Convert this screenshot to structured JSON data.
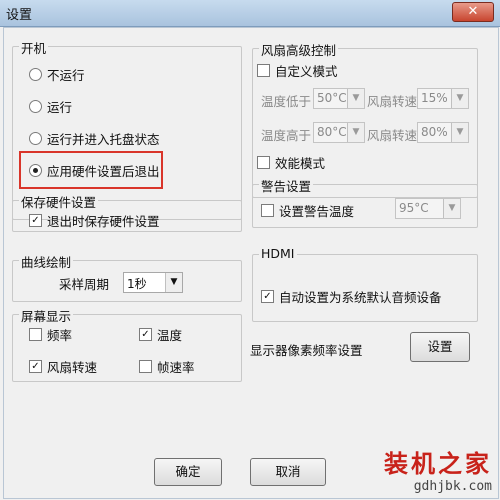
{
  "window": {
    "title": "设置",
    "close_glyph": "✕"
  },
  "startup": {
    "legend": "开机",
    "options": [
      "不运行",
      "运行",
      "运行并进入托盘状态",
      "应用硬件设置后退出"
    ],
    "selected_index": 3
  },
  "save_hw": {
    "legend": "保存硬件设置",
    "option_label": "退出时保存硬件设置",
    "checked": true
  },
  "curve": {
    "legend": "曲线绘制",
    "period_label": "采样周期",
    "period_value": "1秒"
  },
  "display": {
    "legend": "屏幕显示",
    "items": [
      {
        "label": "频率",
        "checked": false
      },
      {
        "label": "温度",
        "checked": true
      },
      {
        "label": "风扇转速",
        "checked": true
      },
      {
        "label": "帧速率",
        "checked": false
      }
    ]
  },
  "fan": {
    "legend": "风扇高级控制",
    "custom_mode_label": "自定义模式",
    "custom_mode_checked": false,
    "temp_low_label": "温度低于",
    "temp_low_value": "50°C",
    "fan_speed_label_1": "风扇转速",
    "fan_speed_value_1": "15%",
    "temp_high_label": "温度高于",
    "temp_high_value": "80°C",
    "fan_speed_label_2": "风扇转速",
    "fan_speed_value_2": "80%",
    "efficiency_label": "效能模式",
    "efficiency_checked": false
  },
  "alarm": {
    "legend": "警告设置",
    "set_temp_label": "设置警告温度",
    "set_temp_checked": false,
    "temp_value": "95°C"
  },
  "hdmi": {
    "legend": "HDMI",
    "auto_label": "自动设置为系统默认音频设备",
    "auto_checked": true
  },
  "pixel_clock": {
    "label": "显示器像素频率设置",
    "button_label": "设置"
  },
  "footer": {
    "ok_label": "确定",
    "cancel_label": "取消"
  },
  "watermark": {
    "brand": "装机之家",
    "url": "gdhjbk.com"
  },
  "colors": {
    "highlight": "#d9352a",
    "title_bar": "#b8cfe6"
  }
}
